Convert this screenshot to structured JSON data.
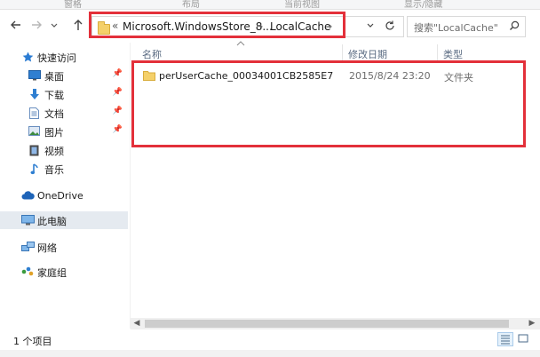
{
  "ribbon": {
    "tabs": [
      "窗格",
      "布局",
      "当前视图",
      "显示/隐藏"
    ]
  },
  "nav": {
    "back_icon": "arrow-left-icon",
    "forward_icon": "arrow-right-icon",
    "history_icon": "chevron-down-icon",
    "up_icon": "arrow-up-icon"
  },
  "address": {
    "overflow": "«",
    "crumbs": [
      "Microsoft.WindowsStore_8...",
      "LocalCache"
    ],
    "separator": "›"
  },
  "search": {
    "placeholder": "搜索\"LocalCache\""
  },
  "sidebar": {
    "quick_access": "快速访问",
    "items": [
      {
        "label": "桌面",
        "icon": "desktop-icon",
        "pinned": true
      },
      {
        "label": "下载",
        "icon": "download-icon",
        "pinned": true
      },
      {
        "label": "文档",
        "icon": "document-icon",
        "pinned": true
      },
      {
        "label": "图片",
        "icon": "picture-icon",
        "pinned": true
      },
      {
        "label": "视频",
        "icon": "video-icon",
        "pinned": false
      },
      {
        "label": "音乐",
        "icon": "music-icon",
        "pinned": false
      }
    ],
    "onedrive": "OneDrive",
    "this_pc": "此电脑",
    "network": "网络",
    "homegroup": "家庭组"
  },
  "columns": {
    "name": "名称",
    "date": "修改日期",
    "type": "类型"
  },
  "files": [
    {
      "name": "perUserCache_00034001CB2585E7",
      "date": "2015/8/24 23:20",
      "type": "文件夹"
    }
  ],
  "status": {
    "count": "1 个项目"
  },
  "colors": {
    "highlight_red": "#e3303a",
    "folder_yellow": "#f4d06a",
    "selected_bg": "#e5eaf0"
  }
}
